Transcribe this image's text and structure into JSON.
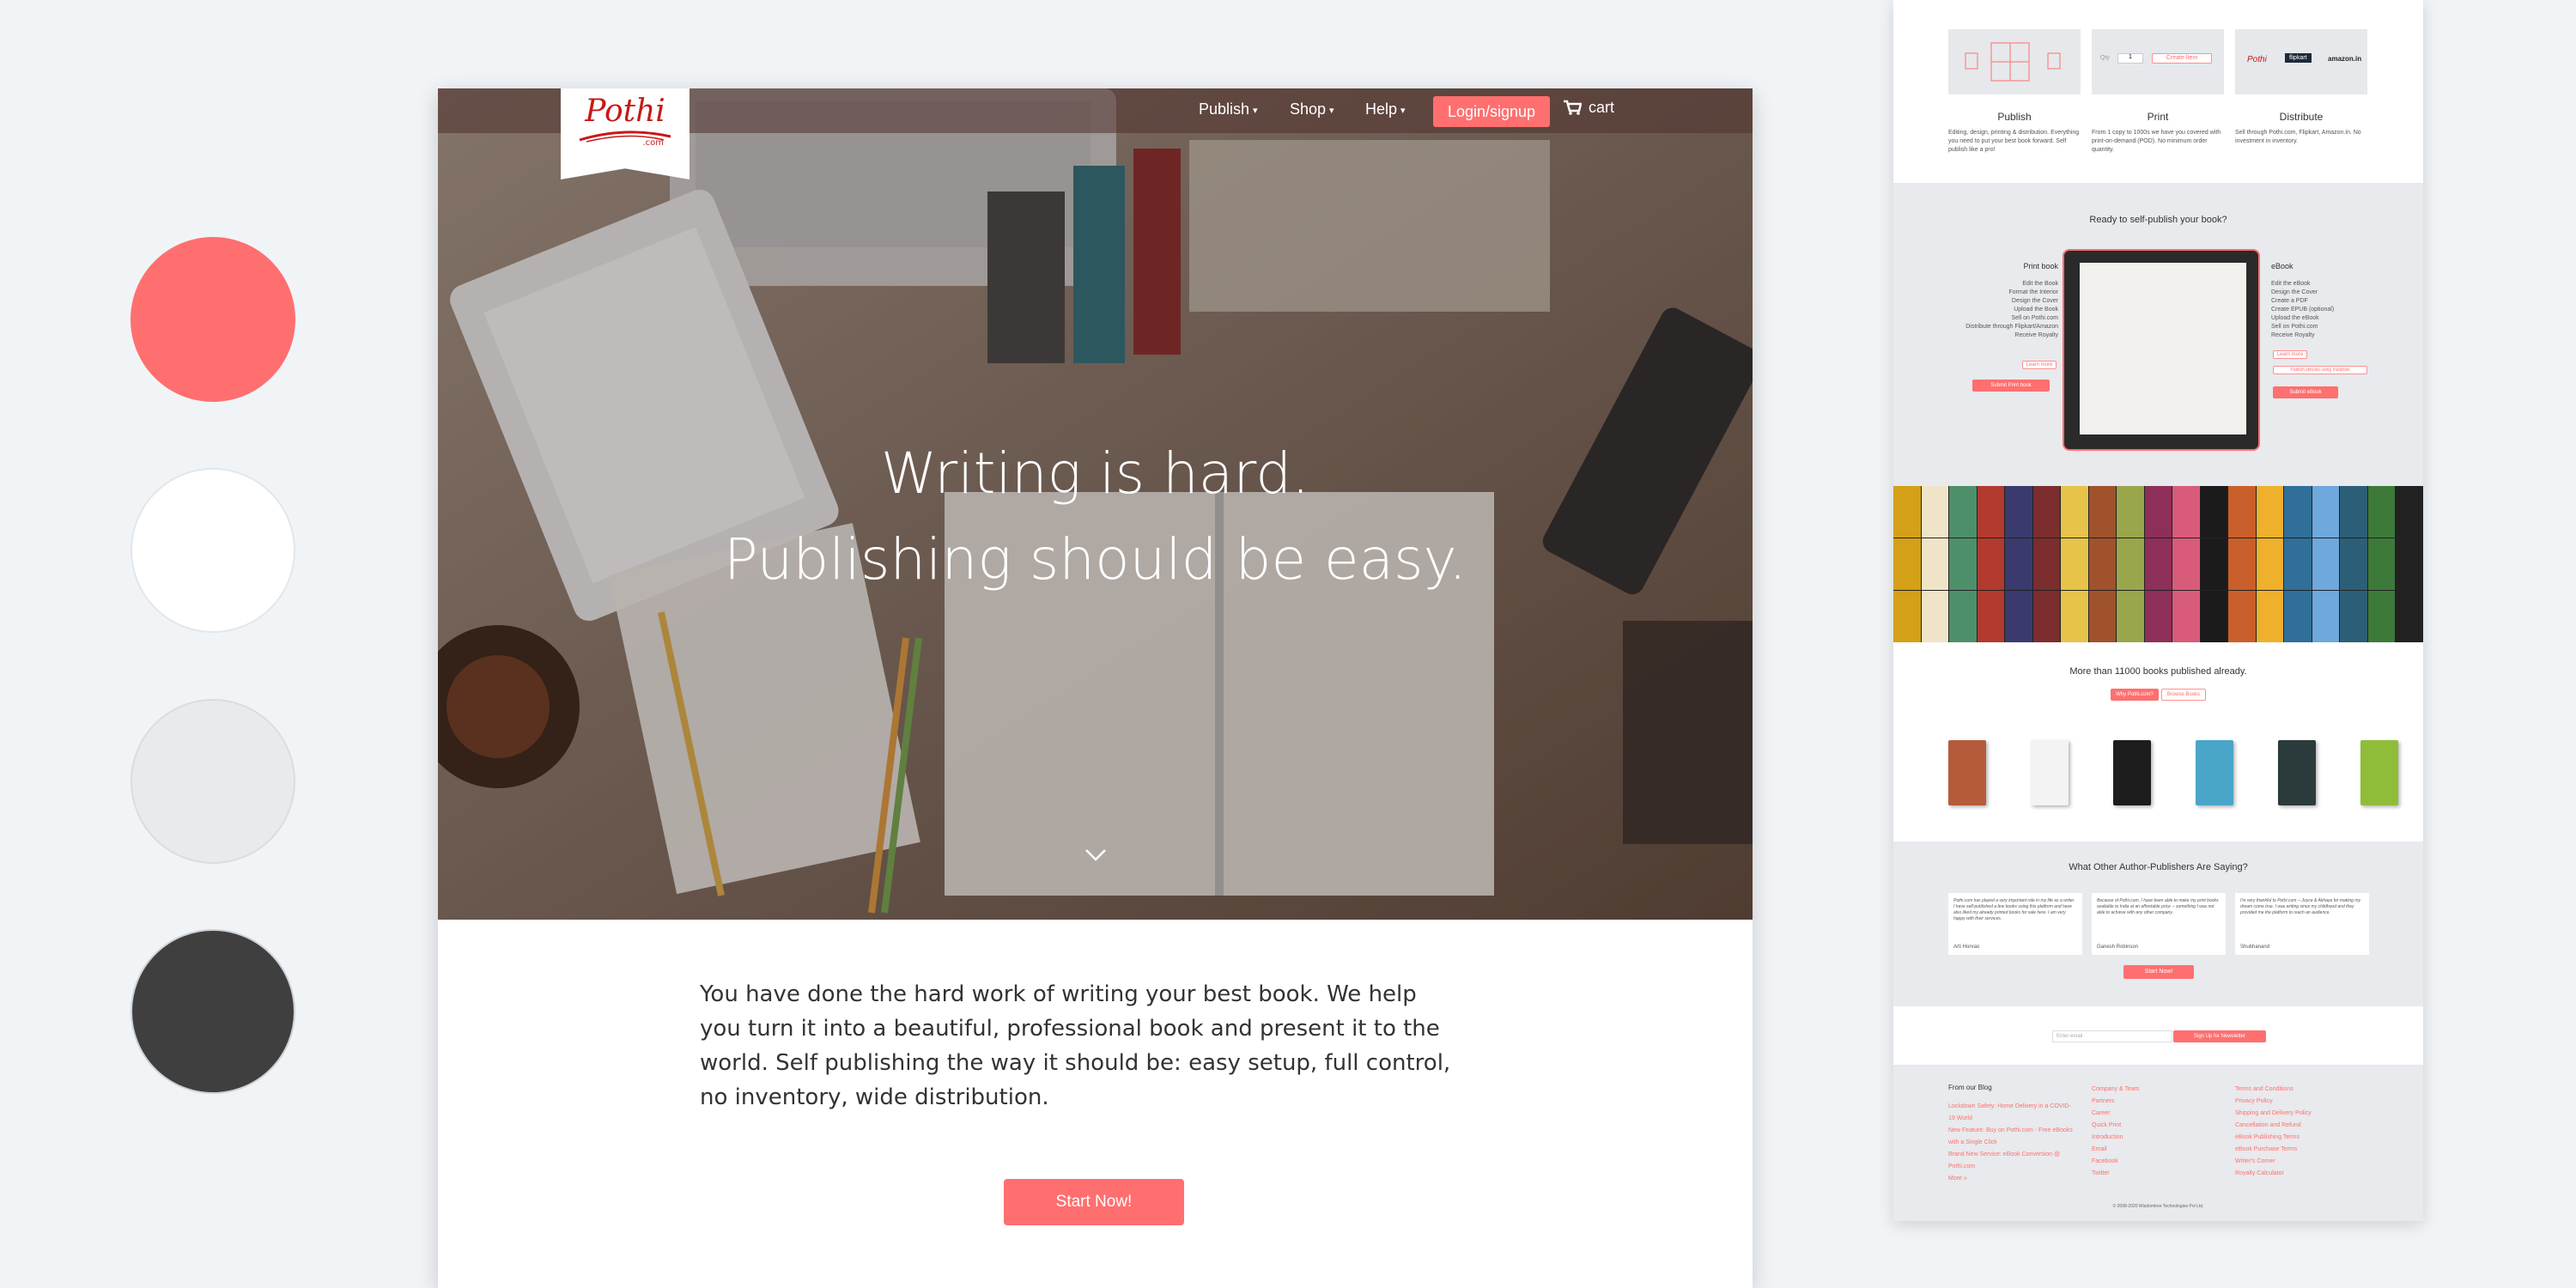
{
  "palette": {
    "swatches": [
      "#ff6f6f",
      "#ffffff",
      "#e8eaec",
      "#3f3f3f"
    ]
  },
  "brand": {
    "logo_text": "Pothi",
    "logo_suffix": ".com"
  },
  "nav": {
    "items": [
      {
        "label": "Publish"
      },
      {
        "label": "Shop"
      },
      {
        "label": "Help"
      }
    ],
    "login_label": "Login/signup",
    "cart_label": "cart"
  },
  "hero": {
    "line1": "Writing is hard.",
    "line2": "Publishing should be easy."
  },
  "intro": {
    "text": "You have done the hard work of writing your best book. We help you turn it into a beautiful, professional book and present it to the world. Self publishing the way it should be: easy setup, full control, no inventory, wide distribution."
  },
  "cta": {
    "start_label": "Start Now!"
  },
  "side": {
    "services": [
      {
        "title": "Publish",
        "desc": "Editing, design, printing & distribution. Everything you need to put your best book forward. Self publish like a pro!"
      },
      {
        "title": "Print",
        "desc": "From 1 copy to 1000s we have you covered with print-on-demand (POD). No minimum order quantity."
      },
      {
        "title": "Distribute",
        "desc": "Sell through Pothi.com, Flipkart, Amazon.in. No investment in inventory."
      }
    ],
    "print_card": {
      "qty": "1",
      "button": "Create Item"
    },
    "distribute_logos": [
      "Pothi",
      "flipkart",
      "amazon.in"
    ],
    "ready_title": "Ready to self-publish your book?",
    "print_book": {
      "title": "Print book",
      "steps": [
        "Edit the Book",
        "Format the Interior",
        "Design the Cover",
        "Upload the Book",
        "Sell on Pothi.com",
        "Distribute through Flipkart/Amazon",
        "Receive Royalty"
      ],
      "learn": "Learn more",
      "submit": "Submit Print book"
    },
    "ebook": {
      "title": "eBook",
      "steps": [
        "Edit the eBook",
        "Design the Cover",
        "Create a PDF",
        "Create EPUB (optional)",
        "Upload the eBook",
        "Sell on Pothi.com",
        "Receive Royalty"
      ],
      "learn": "Learn more",
      "alt_link": "Publish eBooks using Instafolio",
      "submit": "Submit eBook"
    },
    "published_count": "More than 11000 books published already.",
    "tabs": [
      "Why Pothi.com?",
      "Browse Books"
    ],
    "testimonials_title": "What Other Author-Publishers Are Saying?",
    "testimonials": [
      {
        "text": "Pothi.com has played a very important role in my life as a writer. I have self-published a few books using this platform and have also liked my already printed books for sale here. I am very happy with their services.",
        "author": "Arti Honrao"
      },
      {
        "text": "Because of Pothi.com, I have been able to make my print books available to India at an affordable price -- something I was not able to achieve with any other company.",
        "author": "Ganesh Robinson"
      },
      {
        "text": "I'm very thankful to Pothi.com -- Joyce & Akhaya for making my dream come true. I was writing since my childhood and they provided me the platform to reach an audience.",
        "author": "Shubhanand"
      }
    ],
    "testimonials_cta": "Start Now!",
    "newsletter": {
      "placeholder": "Enter email",
      "button": "Sign Up for Newsletter"
    },
    "footer": {
      "blog_title": "From our Blog",
      "blog_links": [
        "Lockdown Safety: Home Delivery in a COVID-19 World",
        "New Feature: Buy on Pothi.com - Free eBooks with a Single Click",
        "Brand New Service: eBook Conversion @ Pothi.com",
        "More »"
      ],
      "col2": [
        "Company & Team",
        "Partners",
        "Career",
        "Quick Print",
        "Introduction",
        "Email",
        "Facebook",
        "Twitter"
      ],
      "col3": [
        "Terms and Conditions",
        "Privacy Policy",
        "Shipping and Delivery Policy",
        "Cancellation and Refund",
        "eBook Publishing Terms",
        "eBook Purchase Terms",
        "Writer's Corner",
        "Royalty Calculator"
      ],
      "copyright": "© 2008-2020 Wisdomtree Technologies Pvt Ltd."
    }
  }
}
